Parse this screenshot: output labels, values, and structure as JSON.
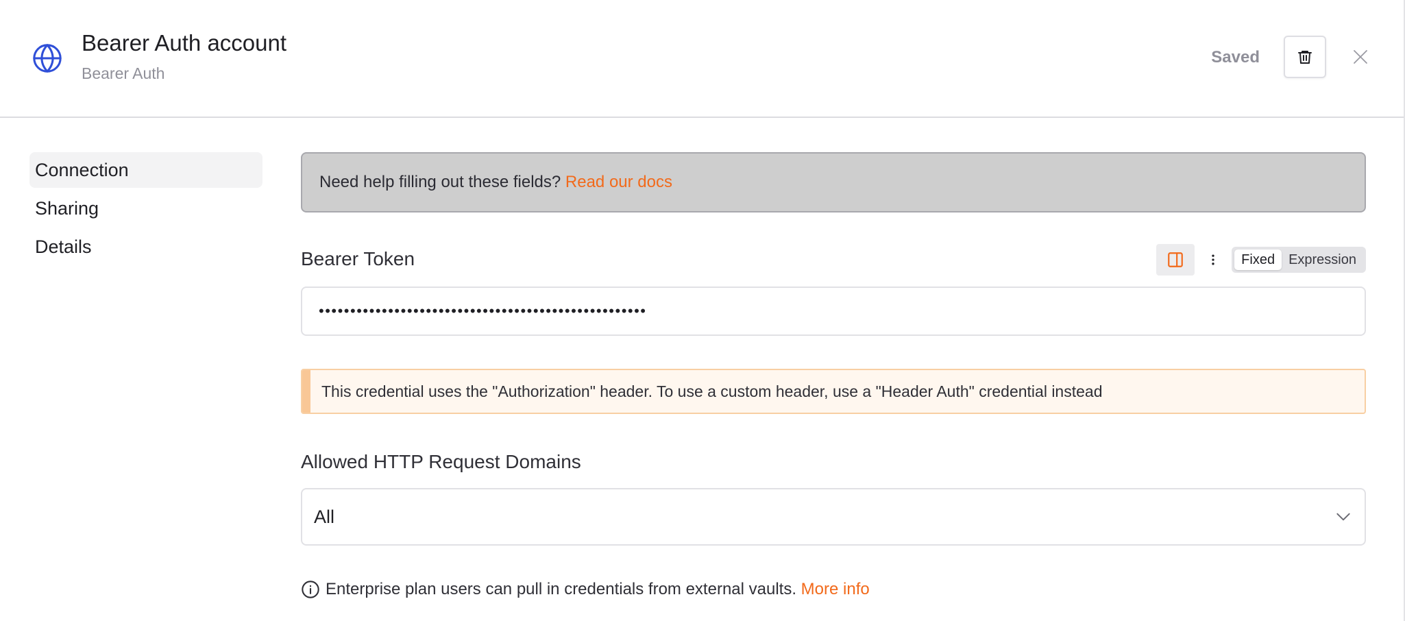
{
  "header": {
    "title": "Bearer Auth account",
    "subtitle": "Bearer Auth",
    "status": "Saved",
    "icon": "globe-icon",
    "delete_icon": "trash-icon",
    "close_icon": "close-icon"
  },
  "sidebar": {
    "items": [
      {
        "label": "Connection",
        "active": true
      },
      {
        "label": "Sharing",
        "active": false
      },
      {
        "label": "Details",
        "active": false
      }
    ]
  },
  "help_banner": {
    "text": "Need help filling out these fields?",
    "link": "Read our docs"
  },
  "bearer_token": {
    "label": "Bearer Token",
    "value": "••••••••••••••••••••••••••••••••••••••••••••••••••••",
    "modes": [
      "Fixed",
      "Expression"
    ],
    "selected_mode": "Fixed"
  },
  "notice": {
    "text": "This credential uses the \"Authorization\" header. To use a custom header, use a \"Header Auth\" credential instead"
  },
  "allowed_domains": {
    "label": "Allowed HTTP Request Domains",
    "value": "All"
  },
  "enterprise_note": {
    "text": "Enterprise plan users can pull in credentials from external vaults.",
    "link": "More info"
  },
  "colors": {
    "accent": "#f26a1b",
    "icon_blue": "#2f4fd8",
    "notice_bg": "#fff7ef",
    "notice_border": "#f8cfa3",
    "banner_bg": "#cecece"
  }
}
